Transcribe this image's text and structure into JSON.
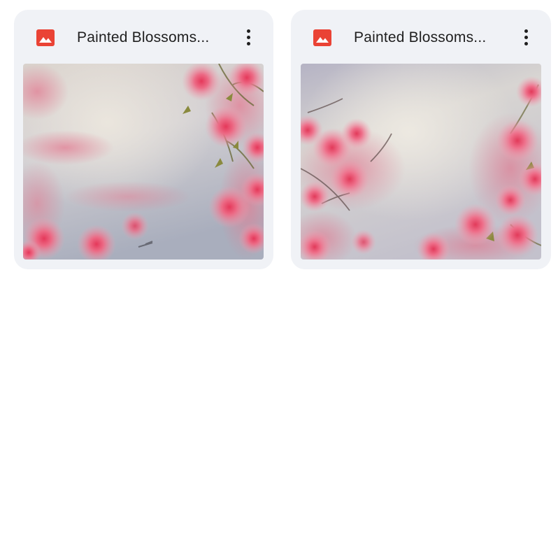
{
  "files": [
    {
      "name": "Painted Blossoms...",
      "icon": "image-icon",
      "icon_color": "#ea4335",
      "more_icon": "more-vert-icon"
    },
    {
      "name": "Painted Blossoms...",
      "icon": "image-icon",
      "icon_color": "#ea4335",
      "more_icon": "more-vert-icon"
    }
  ],
  "colors": {
    "card_background": "#f0f2f6",
    "title_text": "#1f1f1f",
    "blossom_pink": "#e8647e",
    "sky_grey": "#c9c9d2"
  }
}
